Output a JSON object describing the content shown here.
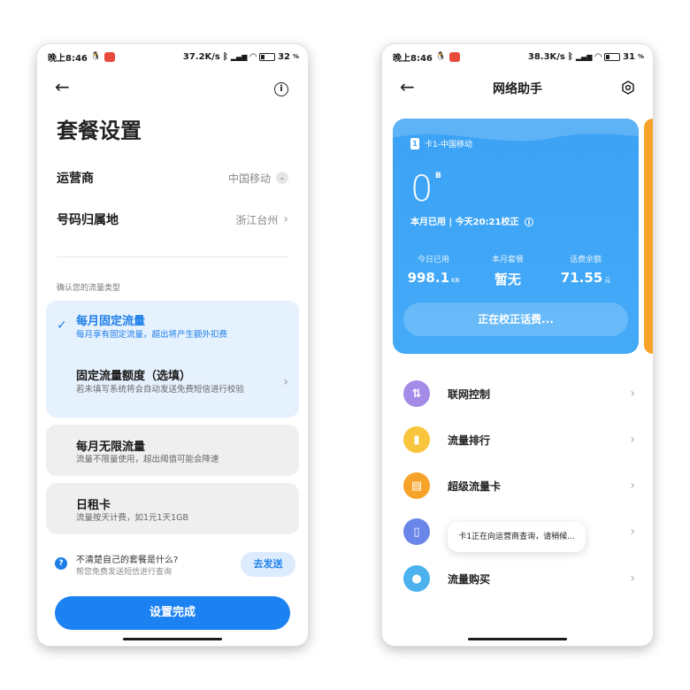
{
  "left": {
    "status": {
      "time": "晚上8:46",
      "speed": "37.2K/s",
      "battery": "32",
      "battery_level": 0.32
    },
    "title": "套餐设置",
    "carrier_row": {
      "label": "运营商",
      "value": "中国移动"
    },
    "location_row": {
      "label": "号码归属地",
      "value": "浙江台州"
    },
    "section_hint": "确认您的流量类型",
    "plan_options": [
      {
        "title": "每月固定流量",
        "subtitle": "每月享有固定流量，超出将产生额外扣费",
        "selected": true
      },
      {
        "title": "固定流量额度（选填）",
        "subtitle": "若未填写系统将会自动发送免费短信进行校验"
      },
      {
        "title": "每月无限流量",
        "subtitle": "流量不限量使用，超出阈值可能会降速"
      },
      {
        "title": "日租卡",
        "subtitle": "流量按天计费，如1元1天1GB"
      }
    ],
    "help": {
      "question": "不清楚自己的套餐是什么?",
      "sub": "帮您免费发送短信进行查询",
      "button": "去发送"
    },
    "done_button": "设置完成"
  },
  "right": {
    "status": {
      "time": "晚上8:46",
      "speed": "38.3K/s",
      "battery": "31",
      "battery_level": 0.31
    },
    "title": "网络助手",
    "card": {
      "sim_label": "卡1-中国移动",
      "usage_value": "0",
      "usage_unit": "B",
      "calibration": "本月已用 | 今天20:21校正",
      "stats": [
        {
          "label": "今日已用",
          "value": "998.1",
          "unit": "KB"
        },
        {
          "label": "本月套餐",
          "value": "暂无",
          "unit": ""
        },
        {
          "label": "话费余额",
          "value": "71.55",
          "unit": "元"
        }
      ],
      "button": "正在校正话费..."
    },
    "menu": [
      {
        "label": "联网控制",
        "icon": "network-control-icon",
        "color": "#a58be8"
      },
      {
        "label": "流量排行",
        "icon": "ranking-icon",
        "color": "#f8c53c"
      },
      {
        "label": "超级流量卡",
        "icon": "sim-card-icon",
        "color": "#f7a32a"
      },
      {
        "label": "",
        "icon": "tablet-icon",
        "color": "#6a86e8"
      },
      {
        "label": "流量购买",
        "icon": "drop-icon",
        "color": "#4bb2ee"
      }
    ],
    "toast": "卡1正在向运营商查询，请稍候..."
  }
}
